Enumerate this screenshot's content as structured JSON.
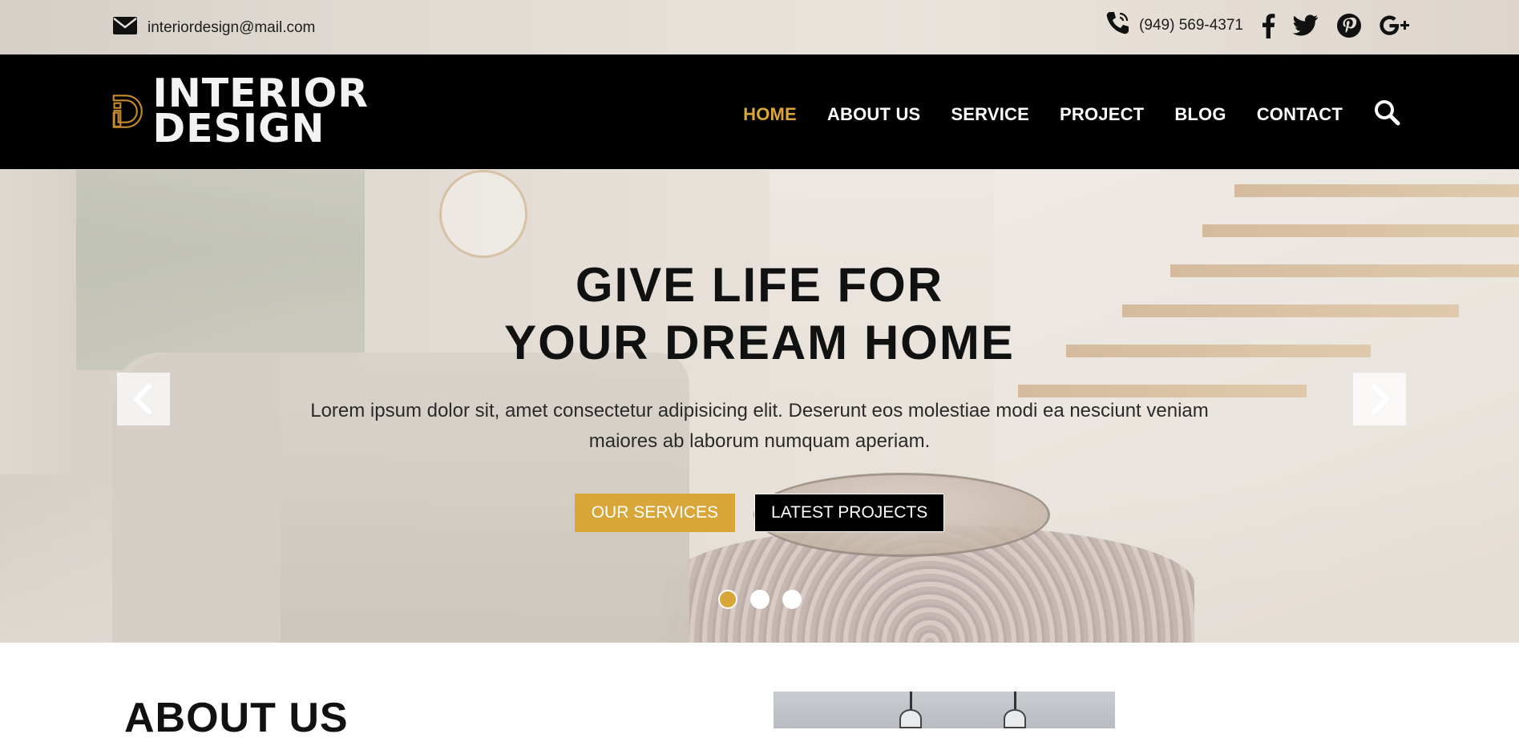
{
  "topbar": {
    "email": "interiordesign@mail.com",
    "phone": "(949) 569-4371",
    "social": [
      "facebook-icon",
      "twitter-icon",
      "pinterest-icon",
      "google-plus-icon"
    ]
  },
  "logo": {
    "line1": "INTERIOR",
    "line2": "DESIGN"
  },
  "nav": {
    "items": [
      {
        "label": "HOME",
        "active": true
      },
      {
        "label": "ABOUT US"
      },
      {
        "label": "SERVICE"
      },
      {
        "label": "PROJECT"
      },
      {
        "label": "BLOG"
      },
      {
        "label": "CONTACT"
      }
    ]
  },
  "hero": {
    "title_line1": "GIVE LIFE FOR",
    "title_line2": "YOUR DREAM HOME",
    "subtitle": "Lorem ipsum dolor sit, amet consectetur adipisicing elit. Deserunt eos molestiae modi ea nesciunt veniam maiores ab laborum numquam aperiam.",
    "button_primary": "OUR SERVICES",
    "button_secondary": "LATEST PROJECTS",
    "slides": 3,
    "active_slide": 1
  },
  "about": {
    "title": "ABOUT US"
  },
  "colors": {
    "accent": "#d9a63a",
    "nav_bg": "#000000",
    "text": "#111111"
  }
}
